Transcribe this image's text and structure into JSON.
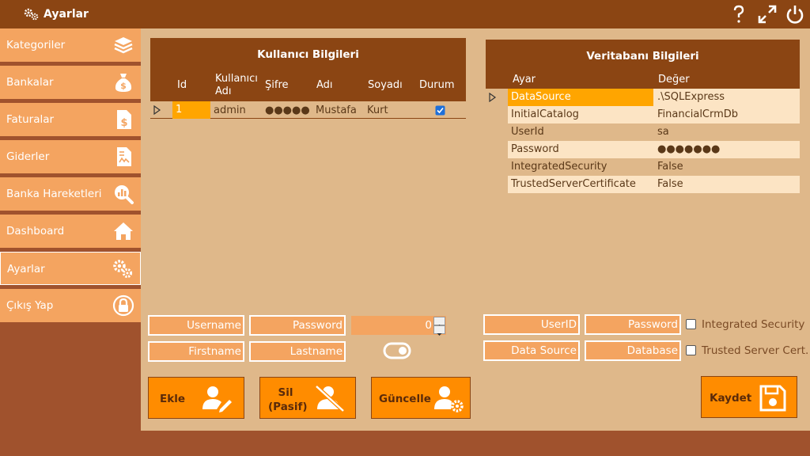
{
  "window": {
    "title": "Ayarlar",
    "icons": [
      "gears-icon",
      "help-icon",
      "resize-icon",
      "power-icon"
    ]
  },
  "sidebar": {
    "items": [
      {
        "label": "Kategoriler",
        "icon": "layers-icon"
      },
      {
        "label": "Bankalar",
        "icon": "money-bag-icon"
      },
      {
        "label": "Faturalar",
        "icon": "invoice-dollar-icon"
      },
      {
        "label": "Giderler",
        "icon": "receipt-icon"
      },
      {
        "label": "Banka Hareketleri",
        "icon": "chart-search-icon"
      },
      {
        "label": "Dashboard",
        "icon": "home-icon"
      },
      {
        "label": "Ayarlar",
        "icon": "gears-icon"
      },
      {
        "label": "Çıkış Yap",
        "icon": "lock-icon"
      }
    ]
  },
  "users_grid": {
    "title": "Kullanıcı Bilgileri",
    "columns": [
      "Id",
      "Kullanıcı Adı",
      "Şifre",
      "Adı",
      "Soyadı",
      "Durum"
    ],
    "rows": [
      {
        "id": "1",
        "username": "admin",
        "password": "●●●●●",
        "firstname": "Mustafa",
        "lastname": "Kurt",
        "status": true
      }
    ]
  },
  "db_grid": {
    "title": "Veritabanı Bilgileri",
    "columns": [
      "Ayar",
      "Değer"
    ],
    "rows": [
      {
        "key": "DataSource",
        "value": ".\\SQLExpress"
      },
      {
        "key": "InitialCatalog",
        "value": "FinancialCrmDb"
      },
      {
        "key": "UserId",
        "value": "sa"
      },
      {
        "key": "Password",
        "value": "●●●●●●●"
      },
      {
        "key": "IntegratedSecurity",
        "value": "False"
      },
      {
        "key": "TrustedServerCertificate",
        "value": "False"
      }
    ]
  },
  "user_form": {
    "username_ph": "Username",
    "password_ph": "Password",
    "firstname_ph": "Firstname",
    "lastname_ph": "Lastname",
    "numeric_value": "0"
  },
  "db_form": {
    "userid_ph": "UserID",
    "password_ph": "Password",
    "datasource_ph": "Data Source",
    "database_ph": "Database",
    "integrated_label": "Integrated Security",
    "trusted_label": "Trusted Server Cert."
  },
  "buttons": {
    "add": "Ekle",
    "delete_line1": "Sil",
    "delete_line2": "(Pasif)",
    "update": "Güncelle",
    "save": "Kaydet"
  },
  "colors": {
    "titlebar": "#8b4513",
    "sidebar": "#a0522d",
    "sidebar_item": "#f4a460",
    "background": "#dfb88a",
    "selected_cell": "#ffa500",
    "button": "#ff8c00"
  }
}
